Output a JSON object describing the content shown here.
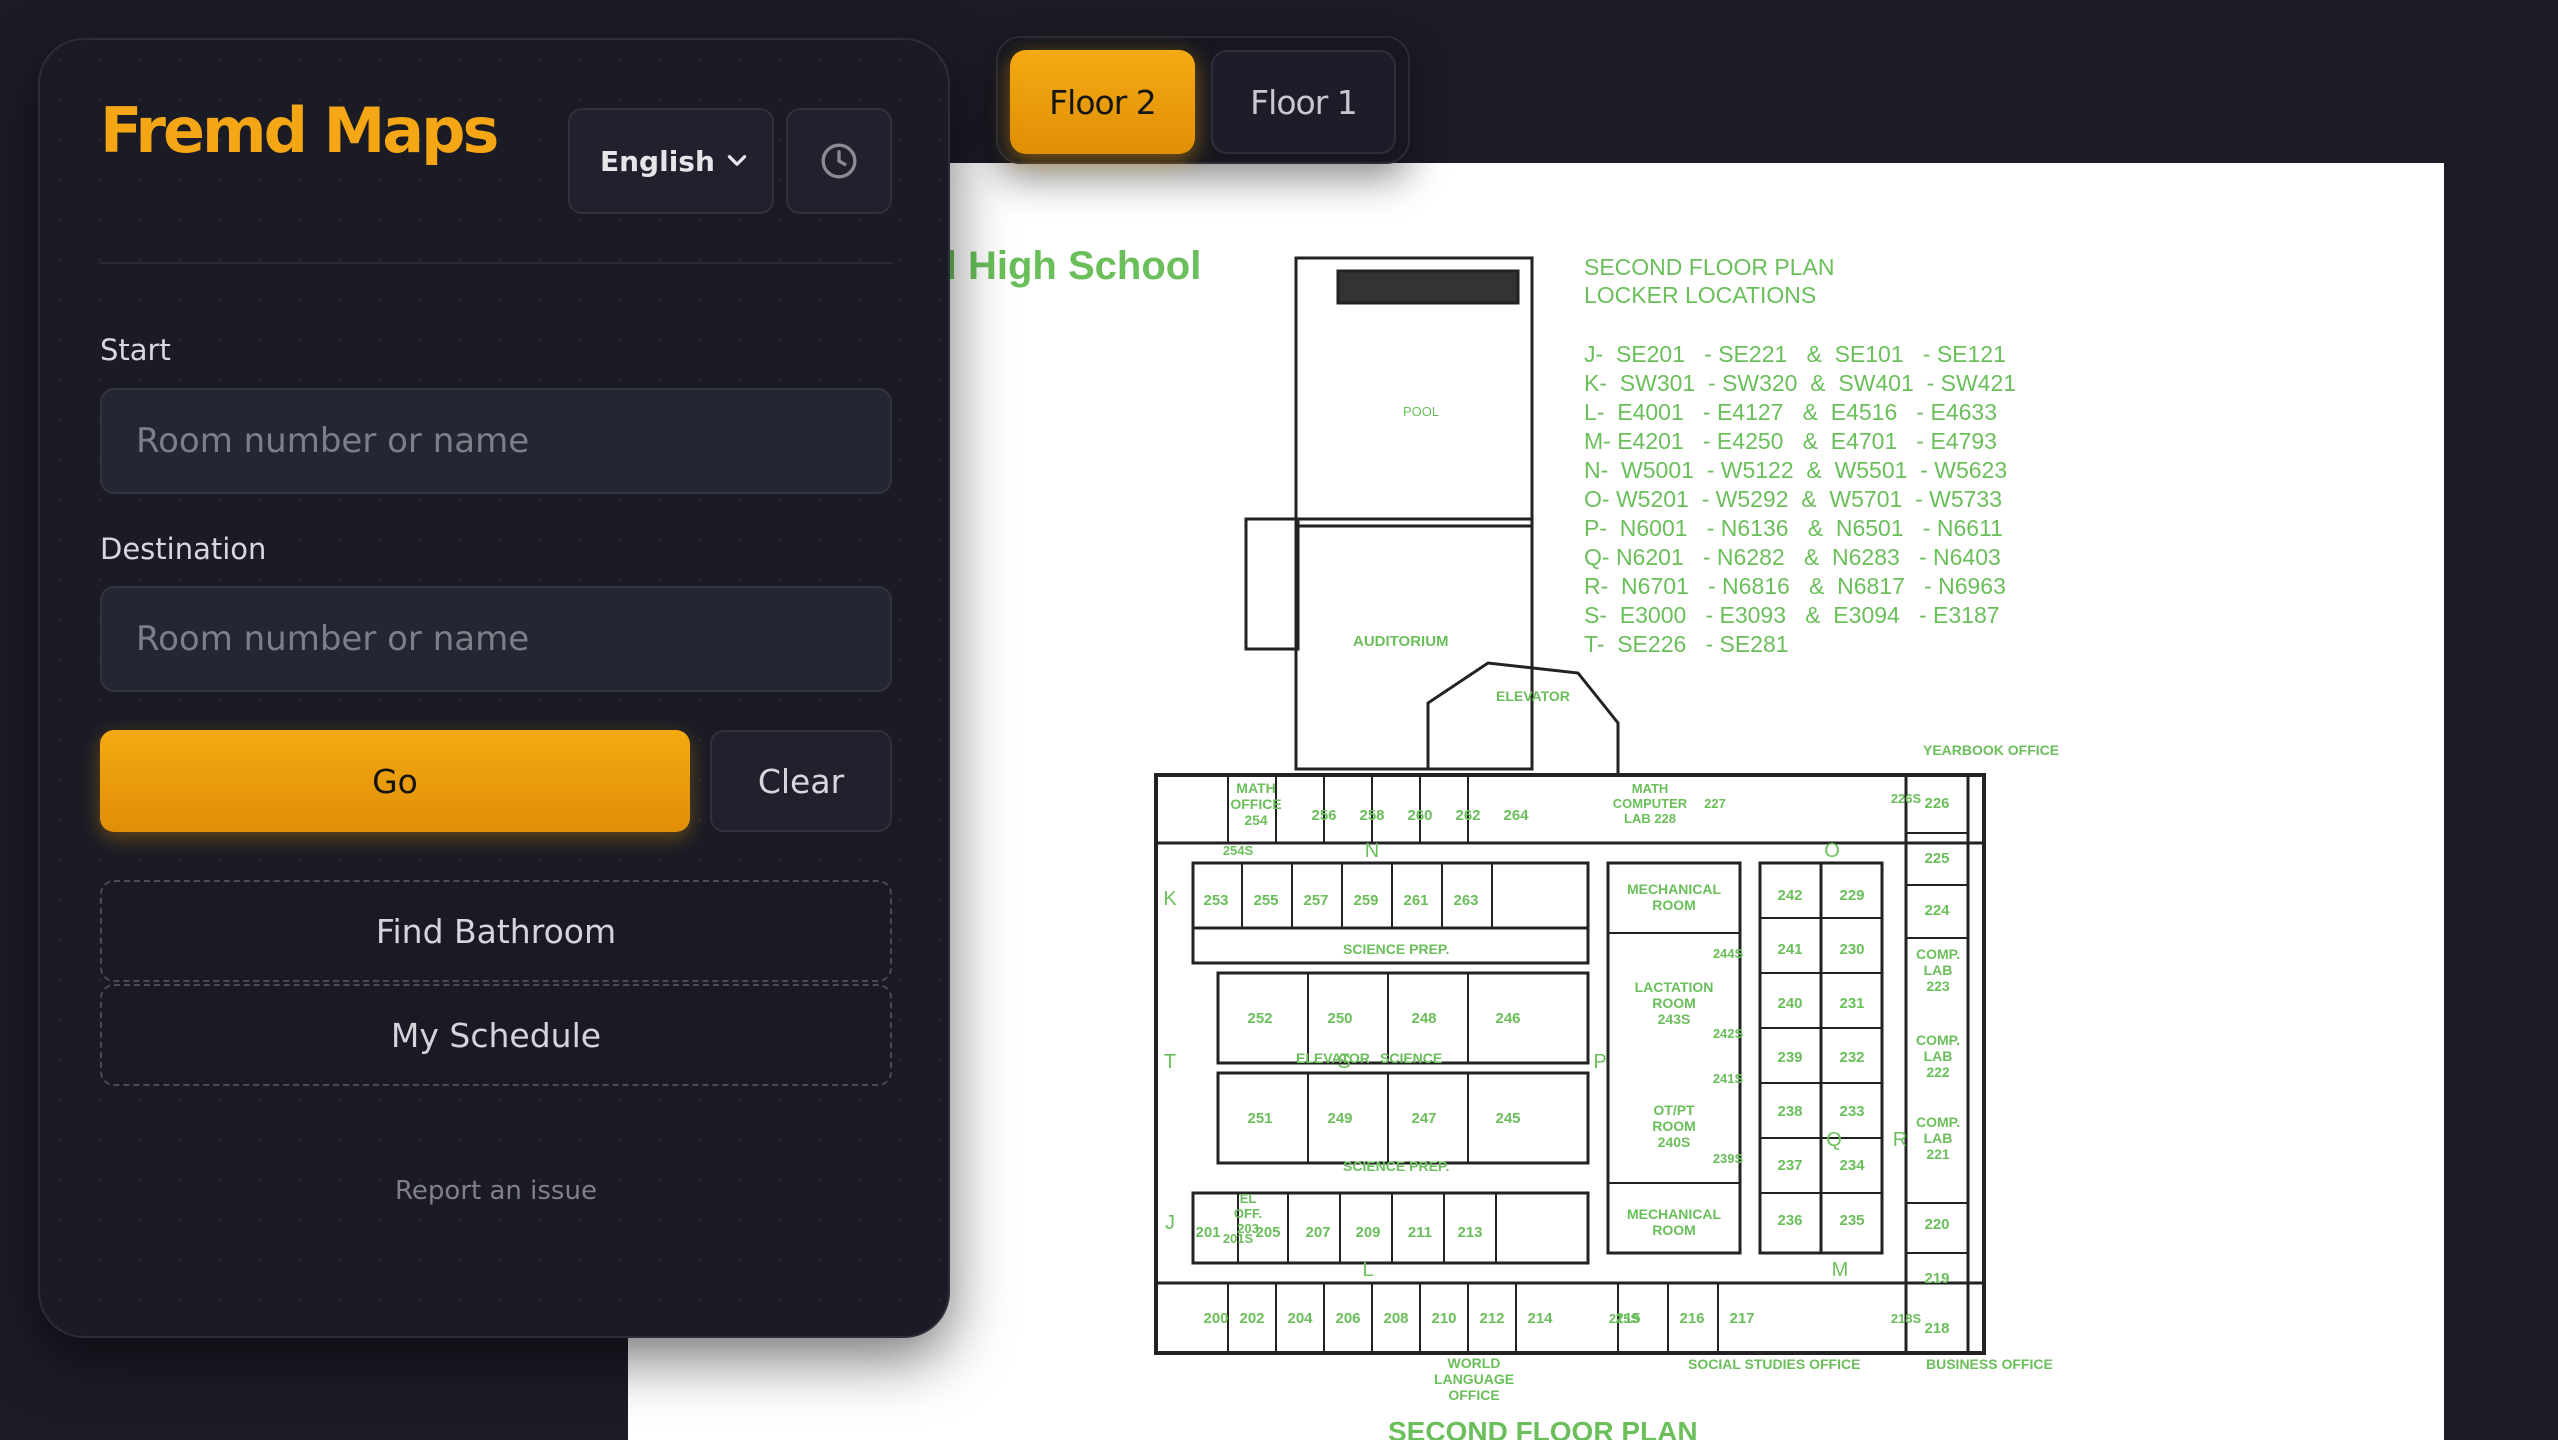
{
  "app": {
    "title": "Fremd Maps"
  },
  "header": {
    "language": "English",
    "floors": [
      "Floor 2",
      "Floor 1"
    ],
    "active_floor": "Floor 2"
  },
  "form": {
    "start_label": "Start",
    "start_placeholder": "Room number or name",
    "destination_label": "Destination",
    "destination_placeholder": "Room number or name",
    "go_label": "Go",
    "clear_label": "Clear",
    "find_bathroom_label": "Find Bathroom",
    "my_schedule_label": "My Schedule",
    "report_label": "Report an issue"
  },
  "map": {
    "title_fragment": "nd High School",
    "plan_heading": "SECOND FLOOR PLAN",
    "locker_heading": "LOCKER LOCATIONS",
    "lockers": [
      "J-  SE201   - SE221   &  SE101   - SE121",
      "K-  SW301  - SW320  &  SW401  - SW421",
      "L-  E4001   - E4127   &  E4516   - E4633",
      "M- E4201   - E4250   &  E4701   - E4793",
      "N-  W5001  - W5122  &  W5501  - W5623",
      "O- W5201  - W5292  &  W5701  - W5733",
      "P-  N6001   - N6136   &  N6501   - N6611",
      "Q- N6201   - N6282   &  N6283   - N6403",
      "R-  N6701   - N6816   &  N6817   - N6963",
      "S-  E3000   - E3093   &  E3094   - E3187",
      "T-  SE226   - SE281"
    ],
    "bottom_caption": "SECOND FLOOR PLAN",
    "labels": {
      "pool": "POOL",
      "auditorium": "AUDITORIUM",
      "elevator": "ELEVATOR",
      "yearbook": "YEARBOOK OFFICE",
      "math_office": [
        "MATH",
        "OFFICE",
        "254"
      ],
      "math_lab": [
        "MATH",
        "COMPUTER",
        "LAB 228"
      ],
      "mech_room": [
        "MECHANICAL",
        "ROOM"
      ],
      "lactation": [
        "LACTATION",
        "ROOM",
        "243S"
      ],
      "otpt": [
        "OT/PT",
        "ROOM",
        "240S"
      ],
      "science_prep": "SCIENCE PREP.",
      "science": "SCIENCE",
      "el_office": [
        "EL",
        "OFF.",
        "203"
      ],
      "comp_lab_223": [
        "COMP.",
        "LAB",
        "223"
      ],
      "comp_lab_222": [
        "COMP.",
        "LAB",
        "222"
      ],
      "comp_lab_221": [
        "COMP.",
        "LAB",
        "221"
      ],
      "world_lang": [
        "WORLD",
        "LANGUAGE",
        "OFFICE"
      ],
      "social_studies": "SOCIAL STUDIES OFFICE",
      "business": "BUSINESS OFFICE"
    },
    "rooms_top_row": [
      "256",
      "258",
      "260",
      "262",
      "264"
    ],
    "rooms_row_n": [
      "253",
      "255",
      "257",
      "259",
      "261",
      "263"
    ],
    "rooms_science_top": [
      "252",
      "250",
      "248",
      "246"
    ],
    "rooms_science_bottom": [
      "251",
      "249",
      "247",
      "245"
    ],
    "rooms_row_j": [
      "201",
      "205",
      "207",
      "209",
      "211",
      "213"
    ],
    "rooms_bottom_row": [
      "200",
      "202",
      "204",
      "206",
      "208",
      "210",
      "212",
      "214",
      "215",
      "216",
      "217"
    ],
    "rooms_inner_left": [
      "242",
      "241",
      "240",
      "239",
      "238",
      "237",
      "236"
    ],
    "rooms_inner_right": [
      "229",
      "230",
      "231",
      "232",
      "233",
      "234",
      "235"
    ],
    "rooms_outer_right": [
      "226",
      "225",
      "224",
      "220",
      "219",
      "218"
    ],
    "misc_rooms": [
      "227",
      "226S",
      "254S",
      "201S",
      "215S",
      "218S",
      "244S",
      "242S",
      "241S",
      "239S"
    ],
    "corridor_letters": [
      "N",
      "O",
      "K",
      "T",
      "S",
      "P",
      "Q",
      "R",
      "J",
      "L",
      "M"
    ]
  }
}
